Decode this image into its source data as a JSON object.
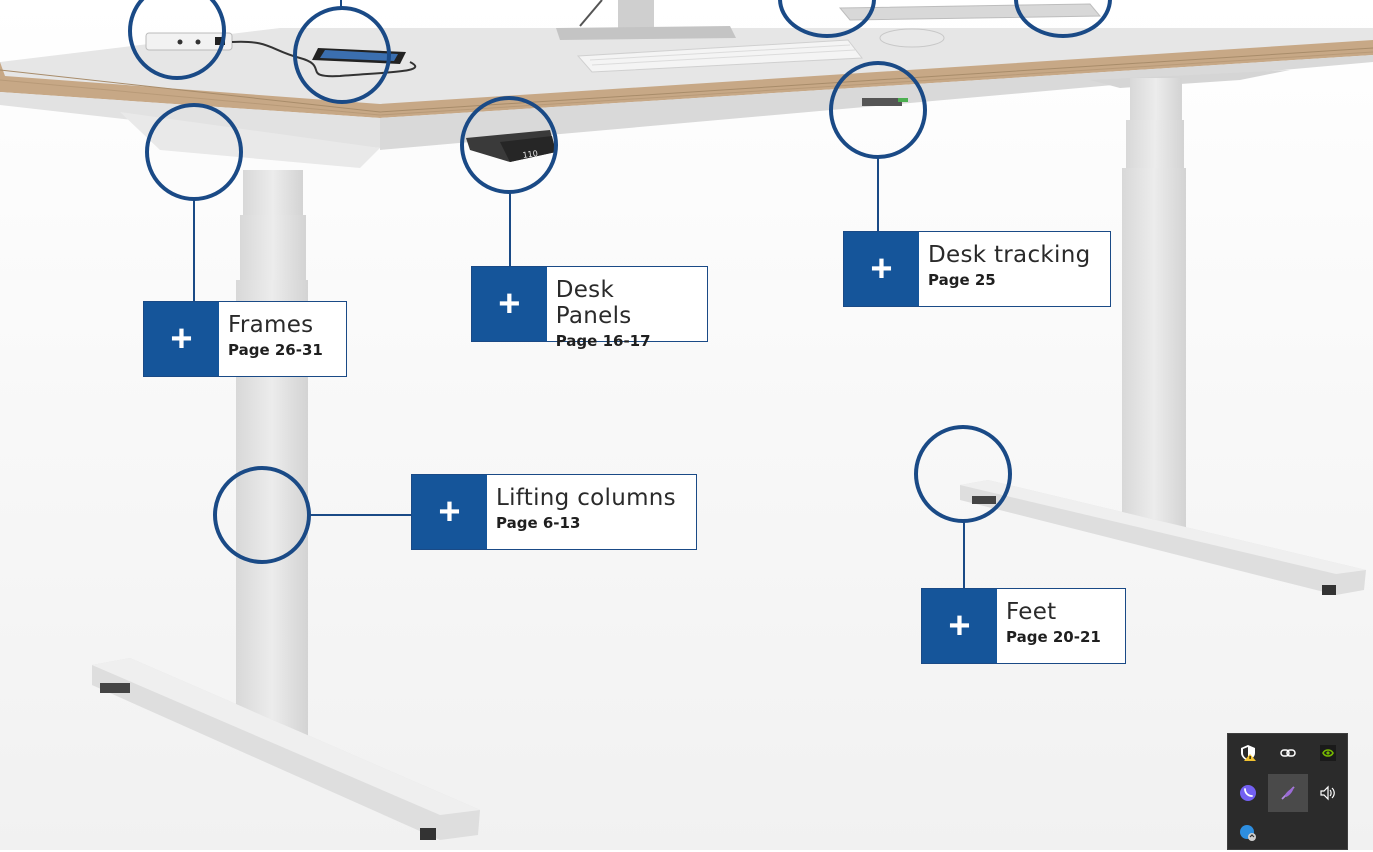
{
  "callouts": [
    {
      "id": "frames",
      "title": "Frames",
      "page": "Page 26-31",
      "plus": "+"
    },
    {
      "id": "desk-panels",
      "title": "Desk Panels",
      "page": "Page 16-17",
      "plus": "+"
    },
    {
      "id": "desk-tracking",
      "title": "Desk tracking",
      "page": "Page 25",
      "plus": "+"
    },
    {
      "id": "lifting-columns",
      "title": "Lifting columns",
      "page": "Page 6-13",
      "plus": "+"
    },
    {
      "id": "feet",
      "title": "Feet",
      "page": "Page 20-21",
      "plus": "+"
    }
  ],
  "panel_display_value": "110",
  "tray": {
    "icons": [
      {
        "name": "security-shield-warning-icon",
        "color": "#ffffff",
        "accent": "#f2c230"
      },
      {
        "name": "link-icon",
        "color": "#ffffff"
      },
      {
        "name": "nvidia-icon",
        "color": "#76b900"
      },
      {
        "name": "viber-icon",
        "color": "#7360f2"
      },
      {
        "name": "feather-pen-icon",
        "color": "#9b6bd6"
      },
      {
        "name": "speaker-volume-icon",
        "color": "#ffffff"
      },
      {
        "name": "onedrive-sync-icon",
        "color": "#2d8ee0"
      }
    ]
  },
  "colors": {
    "accent": "#15559a",
    "outline": "#1a4a86",
    "tray_bg": "#2b2b2b"
  }
}
